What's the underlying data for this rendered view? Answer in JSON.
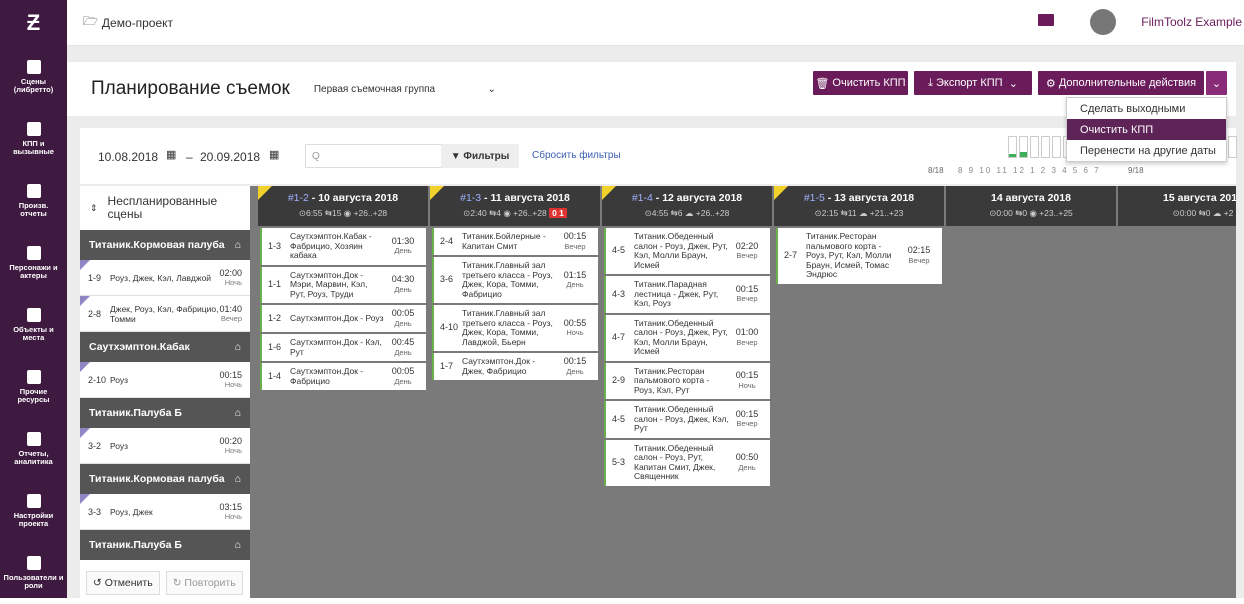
{
  "sidebar": {
    "items": [
      {
        "label": "Сцены\n(либретто)",
        "icon": "script-icon"
      },
      {
        "label": "КПП и\nвызывные",
        "icon": "calendar-icon"
      },
      {
        "label": "Произв.\nотчеты",
        "icon": "checkbox-icon"
      },
      {
        "label": "Персонажи и\nактеры",
        "icon": "people-icon"
      },
      {
        "label": "Объекты и\nместа",
        "icon": "image-icon"
      },
      {
        "label": "Прочие\nресурсы",
        "icon": "box-icon"
      },
      {
        "label": "Отчеты,\nаналитика",
        "icon": "chart-icon"
      },
      {
        "label": "Настройки\nпроекта",
        "icon": "sliders-icon"
      },
      {
        "label": "Пользователи и\nроли",
        "icon": "users-icon"
      }
    ]
  },
  "top": {
    "project": "Демо-проект",
    "user": "FilmToolz Example"
  },
  "header": {
    "title": "Планирование съемок",
    "unit_select": "Первая съемочная группа",
    "clear_label": "Очистить КПП",
    "export_label": "Экспорт КПП",
    "more_label": "Дополнительные действия"
  },
  "menu": {
    "items": [
      "Сделать выходными",
      "Очистить КПП",
      "Перенести на другие даты"
    ]
  },
  "filters": {
    "date_from": "10.08.2018",
    "date_to": "20.09.2018",
    "search_placeholder": "Q",
    "filters_label": "Фильтры",
    "reset_label": "Сбросить фильтры",
    "mini_left": "8/18",
    "mini_right": "9/18",
    "mini_days": "8 9 10 11 12 1 2 3 4 5 6 7"
  },
  "unplanned": {
    "title": "Неспланированные сцены",
    "groups": [
      {
        "name": "Титаник.Кормовая палуба",
        "rows": [
          {
            "n": "1-9",
            "t": "Роуз, Джек, Кэл, Лавджой",
            "time": "02:00",
            "tod": "Ночь"
          },
          {
            "n": "2-8",
            "t": "Джек, Роуз, Кэл, Фабрицио, Томми",
            "time": "01:40",
            "tod": "Вечер"
          }
        ]
      },
      {
        "name": "Саутхэмптон.Кабак",
        "rows": [
          {
            "n": "2-10",
            "t": "Роуз",
            "time": "00:15",
            "tod": "Ночь"
          }
        ]
      },
      {
        "name": "Титаник.Палуба Б",
        "rows": [
          {
            "n": "3-2",
            "t": "Роуз",
            "time": "00:20",
            "tod": "Ночь"
          }
        ]
      },
      {
        "name": "Титаник.Кормовая палуба",
        "rows": [
          {
            "n": "3-3",
            "t": "Роуз, Джек",
            "time": "03:15",
            "tod": "Ночь"
          }
        ]
      },
      {
        "name": "Титаник.Палуба Б",
        "rows": []
      }
    ]
  },
  "undo": {
    "undo_label": "Отменить",
    "redo_label": "Повторить"
  },
  "days": [
    {
      "id": "#1-2",
      "date": "10 августа 2018",
      "info": "⊙6:55 ⇆15 ◉ +26..+28",
      "cards": [
        {
          "n": "1-3",
          "t": "Саутхэмптон.Кабак - Фабрицио, Хозяин кабака",
          "time": "01:30",
          "tod": "День"
        },
        {
          "n": "1-1",
          "t": "Саутхэмптон.Док - Мэри, Марвин, Кэл, Рут, Роуз, Труди",
          "time": "04:30",
          "tod": "День"
        },
        {
          "n": "1-2",
          "t": "Саутхэмптон.Док - Роуз",
          "time": "00:05",
          "tod": "День"
        },
        {
          "n": "1-6",
          "t": "Саутхэмптон.Док - Кэл, Рут",
          "time": "00:45",
          "tod": "День"
        },
        {
          "n": "1-4",
          "t": "Саутхэмптон.Док - Фабрицио",
          "time": "00:05",
          "tod": "День"
        }
      ]
    },
    {
      "id": "#1-3",
      "date": "11 августа 2018",
      "info": "⊙2:40 ⇆4 ◉ +26..+28",
      "badge": "0 1",
      "cards": [
        {
          "n": "2-4",
          "t": "Титаник.Бойлерные - Капитан Смит",
          "time": "00:15",
          "tod": "Вечер"
        },
        {
          "n": "3-6",
          "t": "Титаник.Главный зал третьего класса - Роуз, Джек, Кора, Томми, Фабрицио",
          "time": "01:15",
          "tod": "День"
        },
        {
          "n": "4-10",
          "t": "Титаник.Главный зал третьего класса - Роуз, Джек, Кора, Томми, Лавджой, Бьерн",
          "time": "00:55",
          "tod": "Ночь"
        },
        {
          "n": "1-7",
          "t": "Саутхэмптон.Док - Джек, Фабрицио",
          "time": "00:15",
          "tod": "День"
        }
      ]
    },
    {
      "id": "#1-4",
      "date": "12 августа 2018",
      "info": "⊙4:55 ⇆6 ☁ +26..+28",
      "cards": [
        {
          "n": "4-5",
          "t": "Титаник.Обеденный салон - Роуз, Джек, Рут, Кэл, Молли Браун, Исмей",
          "time": "02:20",
          "tod": "Вечер"
        },
        {
          "n": "4-3",
          "t": "Титаник.Парадная лестница - Джек, Рут, Кэл, Роуз",
          "time": "00:15",
          "tod": "Вечер"
        },
        {
          "n": "4-7",
          "t": "Титаник.Обеденный салон - Роуз, Джек, Рут, Кэл, Молли Браун, Исмей",
          "time": "01:00",
          "tod": "Вечер"
        },
        {
          "n": "2-9",
          "t": "Титаник.Ресторан пальмового корта - Роуз, Кэл, Рут",
          "time": "00:15",
          "tod": "Ночь"
        },
        {
          "n": "4-5",
          "t": "Титаник.Обеденный салон - Роуз, Джек, Кэл, Рут",
          "time": "00:15",
          "tod": "Вечер"
        },
        {
          "n": "5-3",
          "t": "Титаник.Обеденный салон - Роуз, Рут, Капитан Смит, Джек, Священник",
          "time": "00:50",
          "tod": "День"
        }
      ]
    },
    {
      "id": "#1-5",
      "date": "13 августа 2018",
      "info": "⊙2:15 ⇆11 ☁ +21..+23",
      "cards": [
        {
          "n": "2-7",
          "t": "Титаник.Ресторан пальмового корта - Роуз, Рут, Кэл, Молли Браун, Исмей, Томас Эндрюс",
          "time": "02:15",
          "tod": "Вечер"
        }
      ]
    },
    {
      "id": "",
      "date": "14 августа 2018",
      "info": "⊙0:00 ⇆0 ◉ +23..+25",
      "cards": []
    },
    {
      "id": "",
      "date": "15 августа 2018",
      "info": "⊙0:00 ⇆0 ☁ +2",
      "cards": []
    }
  ]
}
